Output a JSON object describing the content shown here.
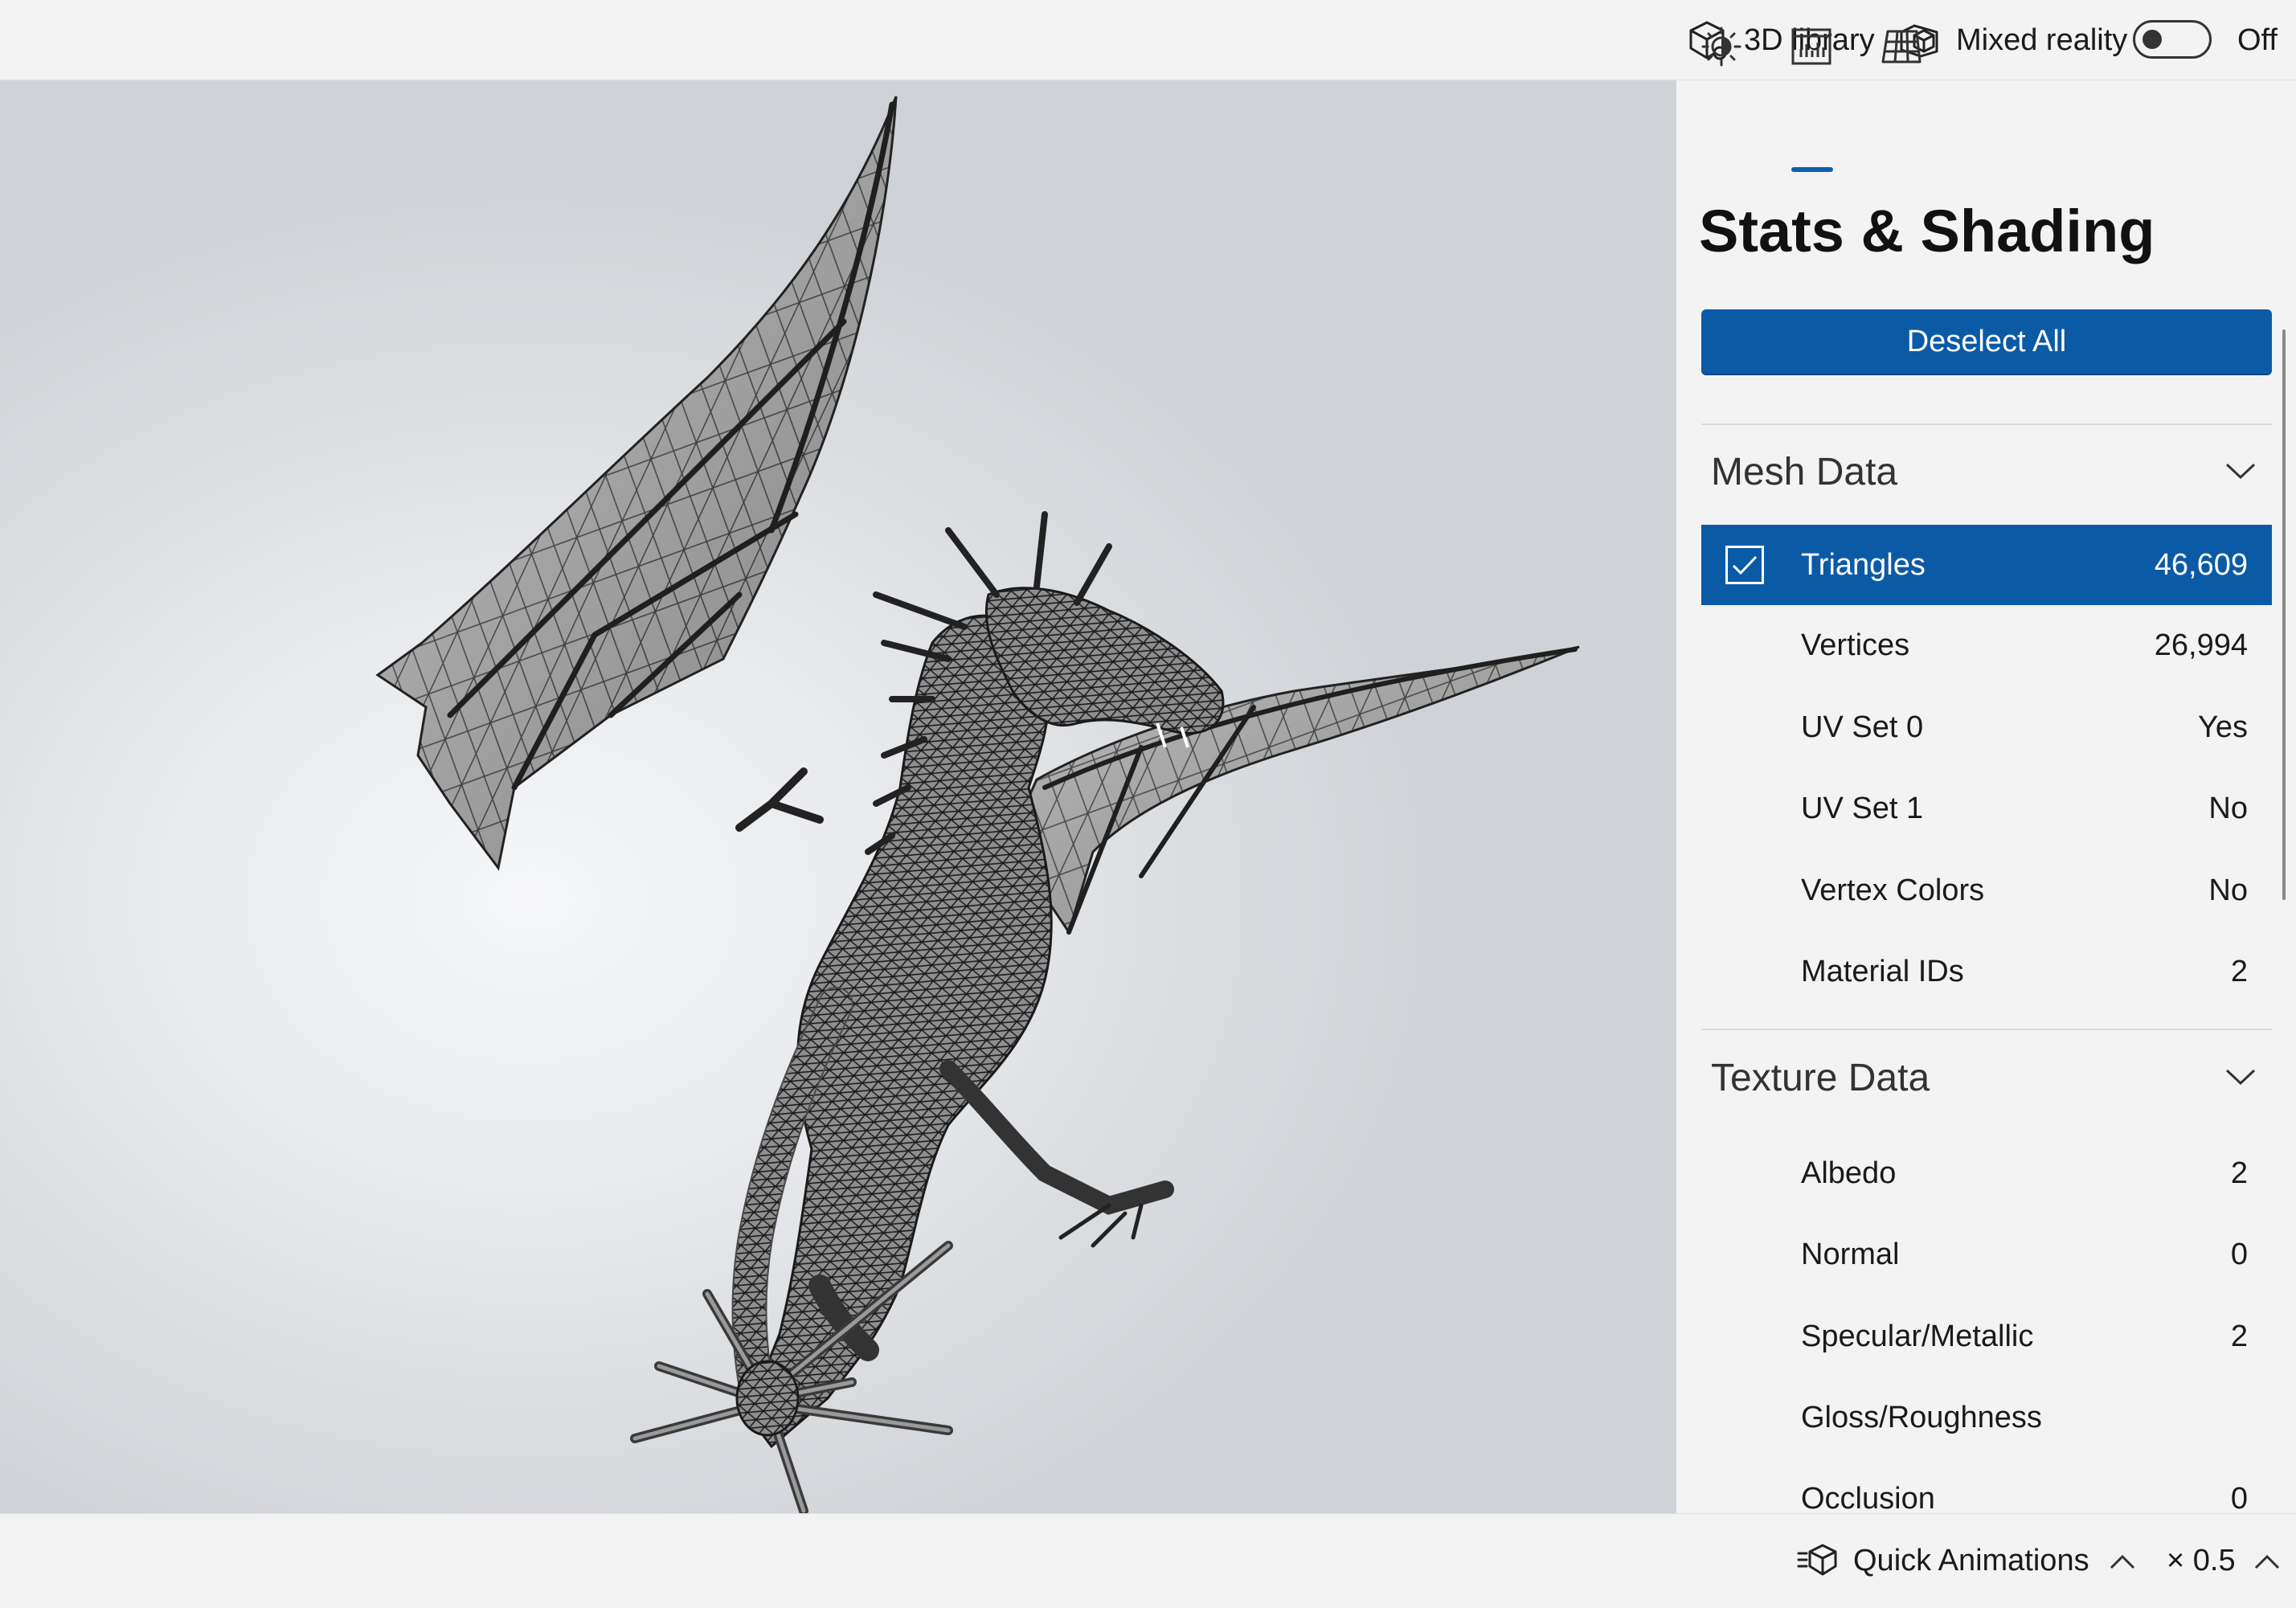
{
  "topbar": {
    "library_label": "3D library",
    "mixed_reality_label": "Mixed reality",
    "toggle_state": "Off"
  },
  "panel": {
    "tabs": [
      {
        "icon": "lighting-icon"
      },
      {
        "icon": "stats-icon",
        "active": true
      },
      {
        "icon": "grid-icon"
      }
    ],
    "title": "Stats & Shading",
    "deselect_label": "Deselect All",
    "mesh": {
      "heading": "Mesh Data",
      "rows": [
        {
          "name": "Triangles",
          "value": "46,609",
          "selected": true
        },
        {
          "name": "Vertices",
          "value": "26,994"
        },
        {
          "name": "UV Set 0",
          "value": "Yes"
        },
        {
          "name": "UV Set 1",
          "value": "No"
        },
        {
          "name": "Vertex Colors",
          "value": "No"
        },
        {
          "name": "Material IDs",
          "value": "2"
        }
      ]
    },
    "texture": {
      "heading": "Texture Data",
      "rows": [
        {
          "name": "Albedo",
          "value": "2"
        },
        {
          "name": "Normal",
          "value": "0"
        },
        {
          "name": "Specular/Metallic",
          "value": "2"
        },
        {
          "name": "Gloss/Roughness",
          "value": ""
        },
        {
          "name": "Occlusion",
          "value": "0"
        }
      ]
    }
  },
  "bottombar": {
    "animations_label": "Quick Animations",
    "speed_label": "× 0.5"
  },
  "colors": {
    "accent": "#0b5aa6",
    "background": "#f3f3f3"
  }
}
